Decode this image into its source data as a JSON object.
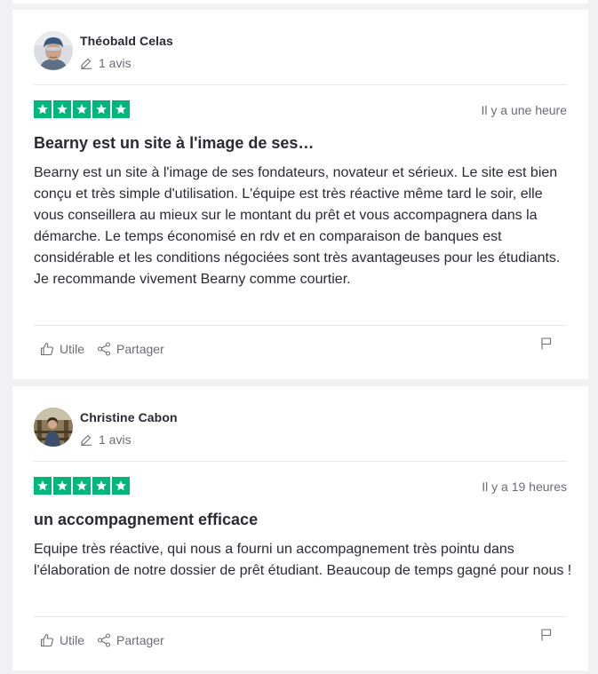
{
  "reviews": [
    {
      "consumer_name": "Théobald Celas",
      "consumer_reviews": "1 avis",
      "rating": 5,
      "date": "Il y a une heure",
      "title": "Bearny est un site à l'image de ses…",
      "text": "Bearny est un site à l'image de ses fondateurs, novateur et sérieux. Le site est bien conçu et très simple d'utilisation. L'équipe est très réactive même tard le soir, elle vous conseillera au mieux sur le montant du prêt et vous accompagnera dans la démarche. Le temps économisé en rdv et en comparaison de banques est considérable et les conditions négociées sont très avantageuses pour les étudiants. Je recommande vivement Bearny comme courtier.",
      "useful_label": "Utile",
      "share_label": "Partager"
    },
    {
      "consumer_name": "Christine Cabon",
      "consumer_reviews": "1 avis",
      "rating": 5,
      "date": "Il y a 19 heures",
      "title": "un accompagnement efficace",
      "text": "Equipe très réactive, qui nous a fourni un accompagnement très pointu dans l'élaboration de notre dossier de prêt étudiant. Beaucoup de temps gagné pour nous !",
      "useful_label": "Utile",
      "share_label": "Partager"
    }
  ],
  "colors": {
    "star_green": "#00b67a",
    "background": "#f1f1f3",
    "card": "#ffffff",
    "muted_text": "#6b6b75"
  },
  "icons": {
    "reviews_count": "pencil-icon",
    "useful": "thumbs-up-icon",
    "share": "share-icon",
    "report": "flag-icon",
    "rating": "star-icon"
  }
}
